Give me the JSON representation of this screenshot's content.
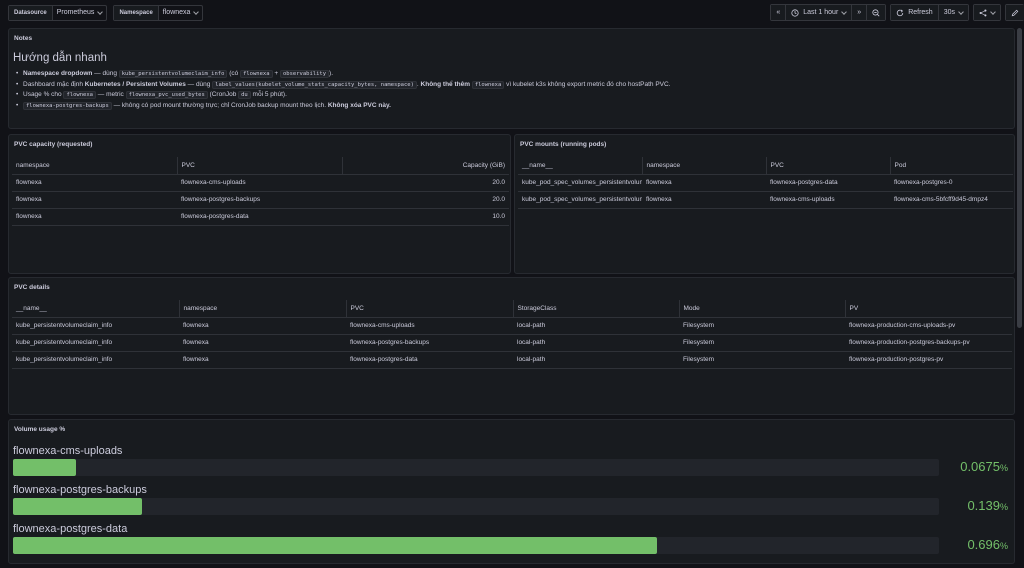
{
  "topbar": {
    "vars": [
      {
        "label": "Datasource",
        "value": "Prometheus"
      },
      {
        "label": "Namespace",
        "value": "flownexa"
      }
    ],
    "time_range": "Last 1 hour",
    "refresh_label": "Refresh",
    "refresh_interval": "30s"
  },
  "notes": {
    "title": "Notes",
    "heading": "Hướng dẫn nhanh",
    "l1": {
      "a": "Namespace dropdown",
      "b": " — dùng ",
      "c": "kube_persistentvolumeclaim_info",
      "d": " (có ",
      "e": "flownexa",
      "f": " + ",
      "g": "observability",
      "h": ")."
    },
    "l2": {
      "a": "Dashboard mặc định ",
      "b": "Kubernetes / Persistent Volumes",
      "c": " — dùng ",
      "d": "label_values(kubelet_volume_stats_capacity_bytes, namespace)",
      "e": ". ",
      "f": "Không thể thêm",
      "g": "flownexa",
      "h": " vì kubelet k3s không export metric đó cho hostPath PVC."
    },
    "l3": {
      "a": "Usage % cho ",
      "b": "flownexa",
      "c": " — metric ",
      "d": "flownexa_pvc_used_bytes",
      "e": " (CronJob ",
      "f": "du",
      "g": " mỗi 5 phút)."
    },
    "l4": {
      "a": "flownexa-postgres-backups",
      "b": " — không có pod mount thường trực; chỉ CronJob backup mount theo lịch. ",
      "c": "Không xóa PVC này."
    }
  },
  "pvc_capacity": {
    "title": "PVC capacity (requested)",
    "headers": [
      "namespace",
      "PVC",
      "Capacity (GiB)"
    ],
    "rows": [
      [
        "flownexa",
        "flownexa-cms-uploads",
        "20.0"
      ],
      [
        "flownexa",
        "flownexa-postgres-backups",
        "20.0"
      ],
      [
        "flownexa",
        "flownexa-postgres-data",
        "10.0"
      ]
    ]
  },
  "pvc_mounts": {
    "title": "PVC mounts (running pods)",
    "headers": [
      "__name__",
      "namespace",
      "PVC",
      "Pod"
    ],
    "rows": [
      [
        "kube_pod_spec_volumes_persistentvolumeclaims_info",
        "flownexa",
        "flownexa-postgres-data",
        "flownexa-postgres-0"
      ],
      [
        "kube_pod_spec_volumes_persistentvolumeclaims_info",
        "flownexa",
        "flownexa-cms-uploads",
        "flownexa-cms-5bfcff9d45-dmpz4"
      ]
    ]
  },
  "pvc_details": {
    "title": "PVC details",
    "headers": [
      "__name__",
      "namespace",
      "PVC",
      "StorageClass",
      "Mode",
      "PV"
    ],
    "rows": [
      [
        "kube_persistentvolumeclaim_info",
        "flownexa",
        "flownexa-cms-uploads",
        "local-path",
        "Filesystem",
        "flownexa-production-cms-uploads-pv"
      ],
      [
        "kube_persistentvolumeclaim_info",
        "flownexa",
        "flownexa-postgres-backups",
        "local-path",
        "Filesystem",
        "flownexa-production-postgres-backups-pv"
      ],
      [
        "kube_persistentvolumeclaim_info",
        "flownexa",
        "flownexa-postgres-data",
        "local-path",
        "Filesystem",
        "flownexa-production-postgres-pv"
      ]
    ]
  },
  "volume_usage": {
    "title": "Volume usage %",
    "accent": "#73bf69",
    "items": [
      {
        "name": "flownexa-cms-uploads",
        "value": "0.0675",
        "unit": "%",
        "pct": 0.0675
      },
      {
        "name": "flownexa-postgres-backups",
        "value": "0.139",
        "unit": "%",
        "pct": 0.139
      },
      {
        "name": "flownexa-postgres-data",
        "value": "0.696",
        "unit": "%",
        "pct": 0.696
      }
    ]
  }
}
